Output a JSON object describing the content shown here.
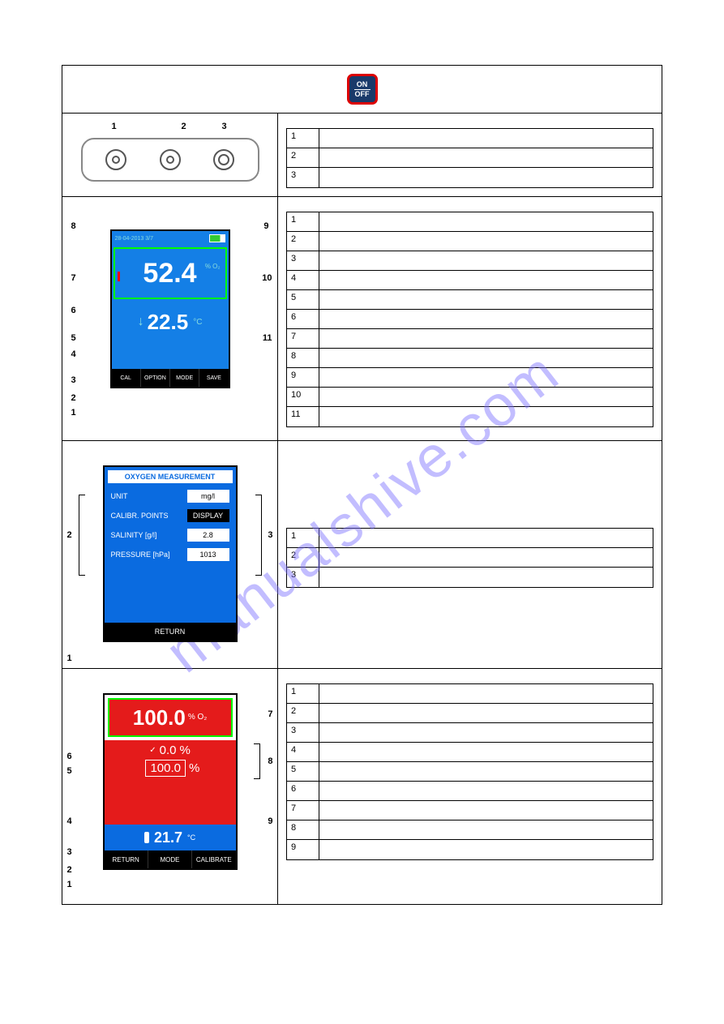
{
  "watermark": "manualshive.com",
  "onoff": {
    "line1": "ON",
    "line2": "OFF"
  },
  "jacks": {
    "l1": "1",
    "l2": "2",
    "l3": "3"
  },
  "scr1": {
    "date": "28-04-2013  3/7",
    "mainValue": "52.4",
    "mainUnit": "%\nO₂",
    "tempArrow": "↓",
    "tempValue": "22.5",
    "tempUnit": "°C",
    "fkeys": [
      "CAL",
      "OPTION",
      "MODE",
      "SAVE"
    ],
    "callouts": [
      "1",
      "2",
      "3",
      "4",
      "5",
      "6",
      "7",
      "8",
      "9",
      "10",
      "11"
    ]
  },
  "scr2": {
    "title": "OXYGEN MEASUREMENT",
    "rows": [
      {
        "lbl": "UNIT",
        "val": "mg/l"
      },
      {
        "lbl": "CALIBR. POINTS",
        "val": "DISPLAY",
        "black": true
      },
      {
        "lbl": "SALINITY  [g/l]",
        "val": "2.8"
      },
      {
        "lbl": "PRESSURE  [hPa]",
        "val": "1013"
      }
    ],
    "foot": "RETURN",
    "callouts": [
      "1",
      "2",
      "3"
    ]
  },
  "scr3": {
    "topValue": "100.0",
    "topUnit": "%\nO₂",
    "row1": {
      "val": "0.0",
      "u": "%"
    },
    "row2": {
      "val": "100.0",
      "u": "%"
    },
    "tempValue": "21.7",
    "tempUnit": "°C",
    "fkeys": [
      "RETURN",
      "MODE",
      "CALIBRATE"
    ],
    "callouts": [
      "1",
      "2",
      "3",
      "4",
      "5",
      "6",
      "7",
      "8",
      "9"
    ]
  },
  "tables": {
    "jacks": [
      {
        "n": "1",
        "t": ""
      },
      {
        "n": "2",
        "t": ""
      },
      {
        "n": "3",
        "t": ""
      }
    ],
    "scr1": [
      {
        "n": "1",
        "t": ""
      },
      {
        "n": "2",
        "t": ""
      },
      {
        "n": "3",
        "t": ""
      },
      {
        "n": "4",
        "t": ""
      },
      {
        "n": "5",
        "t": ""
      },
      {
        "n": "6",
        "t": ""
      },
      {
        "n": "7",
        "t": ""
      },
      {
        "n": "8",
        "t": ""
      },
      {
        "n": "9",
        "t": ""
      },
      {
        "n": "10",
        "t": ""
      },
      {
        "n": "11",
        "t": ""
      }
    ],
    "scr2": [
      {
        "n": "1",
        "t": ""
      },
      {
        "n": "2",
        "t": ""
      },
      {
        "n": "3",
        "t": ""
      }
    ],
    "scr3": [
      {
        "n": "1",
        "t": ""
      },
      {
        "n": "2",
        "t": ""
      },
      {
        "n": "3",
        "t": ""
      },
      {
        "n": "4",
        "t": ""
      },
      {
        "n": "5",
        "t": ""
      },
      {
        "n": "6",
        "t": ""
      },
      {
        "n": "7",
        "t": ""
      },
      {
        "n": "8",
        "t": ""
      },
      {
        "n": "9",
        "t": ""
      }
    ]
  }
}
